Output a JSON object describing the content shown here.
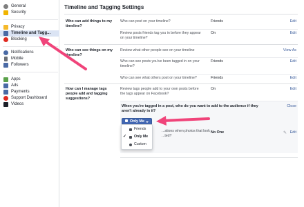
{
  "sidebar": {
    "group1": [
      {
        "label": "General",
        "icon": "gear-icon",
        "color": "#7f7f7f"
      },
      {
        "label": "Security",
        "icon": "shield-icon",
        "color": "#f0b400"
      }
    ],
    "group2": [
      {
        "label": "Privacy",
        "icon": "lock-icon",
        "color": "#f5b92a"
      },
      {
        "label": "Timeline and Tagg...",
        "icon": "timeline-icon",
        "color": "#4a6aa5",
        "active": true
      },
      {
        "label": "Blocking",
        "icon": "blocking-icon",
        "color": "#e02a20"
      }
    ],
    "group3": [
      {
        "label": "Notifications",
        "icon": "globe-icon",
        "color": "#4a6aa5"
      },
      {
        "label": "Mobile",
        "icon": "mobile-icon",
        "color": "#6b6f76"
      },
      {
        "label": "Followers",
        "icon": "followers-icon",
        "color": "#4a6aa5"
      }
    ],
    "group4": [
      {
        "label": "Apps",
        "icon": "apps-icon",
        "color": "#5aa14a"
      },
      {
        "label": "Ads",
        "icon": "ads-icon",
        "color": "#4a6aa5"
      },
      {
        "label": "Payments",
        "icon": "payments-icon",
        "color": "#4a6aa5"
      },
      {
        "label": "Support Dashboard",
        "icon": "support-icon",
        "color": "#e02a20"
      },
      {
        "label": "Videos",
        "icon": "videos-icon",
        "color": "#1d2129"
      }
    ]
  },
  "main": {
    "title": "Timeline and Tagging Settings",
    "sections": [
      {
        "label": "Who can add things to my timeline?",
        "rows": [
          {
            "question": "Who can post on your timeline?",
            "value": "Friends",
            "action": "Edit"
          },
          {
            "question": "Review posts friends tag you in before they appear on your timeline?",
            "value": "On",
            "action": "Edit"
          }
        ]
      },
      {
        "label": "Who can see things on my timeline?",
        "rows": [
          {
            "question": "Review what other people see on your timeline",
            "value": "",
            "action": "View As"
          },
          {
            "question": "Who can see posts you've been tagged in on your timeline?",
            "value": "Friends",
            "action": "Edit"
          },
          {
            "question": "Who can see what others post on your timeline?",
            "value": "Friends",
            "action": "Edit"
          }
        ]
      },
      {
        "label": "How can I manage tags people add and tagging suggestions?",
        "rows": [
          {
            "question": "Review tags people add to your own posts before the tags appear on Facebook?",
            "value": "On",
            "action": "Edit"
          }
        ]
      }
    ],
    "expanded": {
      "question": "When you're tagged in a post, who do you want to add to the audience if they aren't already in it?",
      "close": "Close",
      "audience_button": "Only Me",
      "question2": "...stions when photos that look ...ted?",
      "value2": "No One",
      "action2": "Edit"
    },
    "dropdown": {
      "options": [
        {
          "label": "Friends",
          "icon": "friends-icon",
          "selected": false
        },
        {
          "label": "Only Me",
          "icon": "lock-icon",
          "selected": true
        },
        {
          "label": "Custom",
          "icon": "gear-icon",
          "selected": false
        }
      ],
      "check": "✓"
    }
  },
  "colors": {
    "accent": "#4267b2",
    "link": "#365899",
    "annotation_arrow": "#f0447a"
  }
}
